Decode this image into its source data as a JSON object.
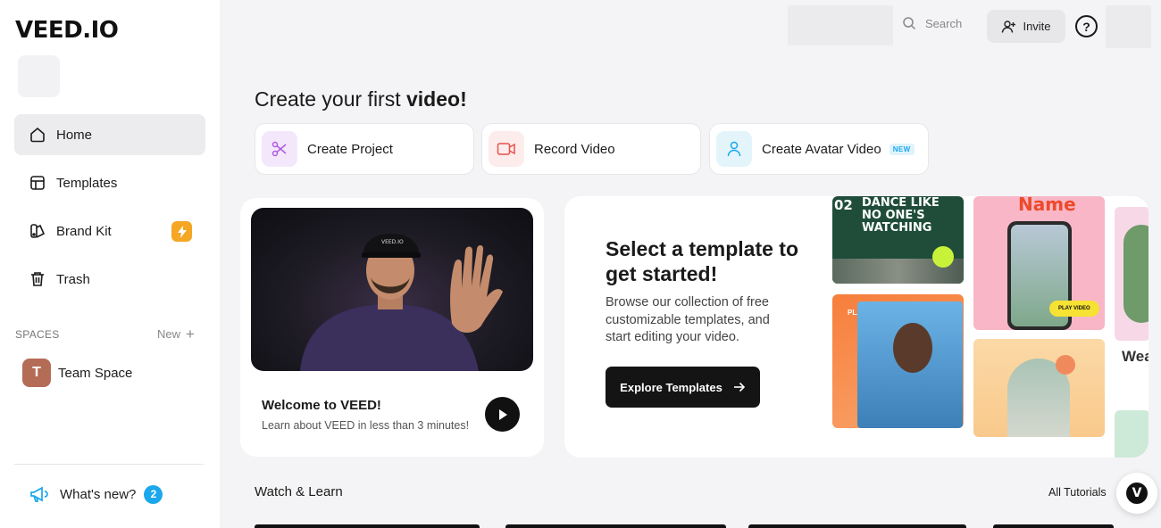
{
  "brand": {
    "logo_text": "VEED.IO"
  },
  "sidebar": {
    "items": [
      {
        "label": "Home",
        "icon": "home-icon",
        "active": true
      },
      {
        "label": "Templates",
        "icon": "templates-icon"
      },
      {
        "label": "Brand Kit",
        "icon": "brand-kit-icon",
        "badge_icon": "lightning-icon"
      },
      {
        "label": "Trash",
        "icon": "trash-icon"
      }
    ],
    "spaces_label": "SPACES",
    "spaces_new": "New",
    "team_space": {
      "initial": "T",
      "label": "Team Space"
    },
    "whats_new": {
      "label": "What's new?",
      "count": "2"
    }
  },
  "topbar": {
    "search_label": "Search",
    "invite_label": "Invite",
    "help_label": "?"
  },
  "main": {
    "headline_prefix": "Create your first ",
    "headline_bold": "video!",
    "actions": [
      {
        "label": "Create Project",
        "icon": "scissors-icon"
      },
      {
        "label": "Record Video",
        "icon": "record-icon"
      },
      {
        "label": "Create Avatar Video",
        "icon": "avatar-icon",
        "tag": "NEW"
      }
    ],
    "welcome": {
      "title": "Welcome to VEED!",
      "subtitle": "Learn about VEED in less than 3 minutes!",
      "cap_text": "VEED.IO"
    },
    "templates": {
      "title": "Select a template to get started!",
      "description": "Browse our collection of free customizable templates, and start editing your video.",
      "button": "Explore Templates",
      "tile1_num": "02",
      "tile1_text": "DANCE LIKE NO ONE'S WATCHING",
      "tile2_text": "PLAY",
      "tile3_text": "Name",
      "tile3_badge": "PLAY VIDEO",
      "tile5_text": "Wea"
    },
    "watch_learn": "Watch & Learn",
    "all_tutorials": "All Tutorials",
    "fab_letter": "V"
  },
  "colors": {
    "accent_blue": "#1aa7ec",
    "brand_kit_badge": "#f5a623",
    "scissors_bg": "#f3e8fb",
    "record_bg": "#fdecec",
    "avatar_bg": "#e4f4fb"
  }
}
